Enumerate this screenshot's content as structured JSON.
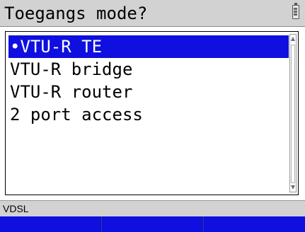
{
  "header": {
    "title": "Toegangs mode?",
    "battery_icon": "battery-icon"
  },
  "access_modes": {
    "bullet": "•",
    "items": [
      {
        "label": "VTU-R TE",
        "selected": true
      },
      {
        "label": "VTU-R bridge",
        "selected": false
      },
      {
        "label": "VTU-R router",
        "selected": false
      },
      {
        "label": "2 port access",
        "selected": false
      }
    ]
  },
  "scrollbar": {
    "up_icon": "▲",
    "down_icon": "▼"
  },
  "status": {
    "text": "VDSL"
  },
  "softkeys": [
    "",
    "",
    ""
  ],
  "colors": {
    "highlight": "#0f0fe0",
    "title_bar": "#d2d2d2",
    "softkey_bar": "#0f0fe0"
  }
}
